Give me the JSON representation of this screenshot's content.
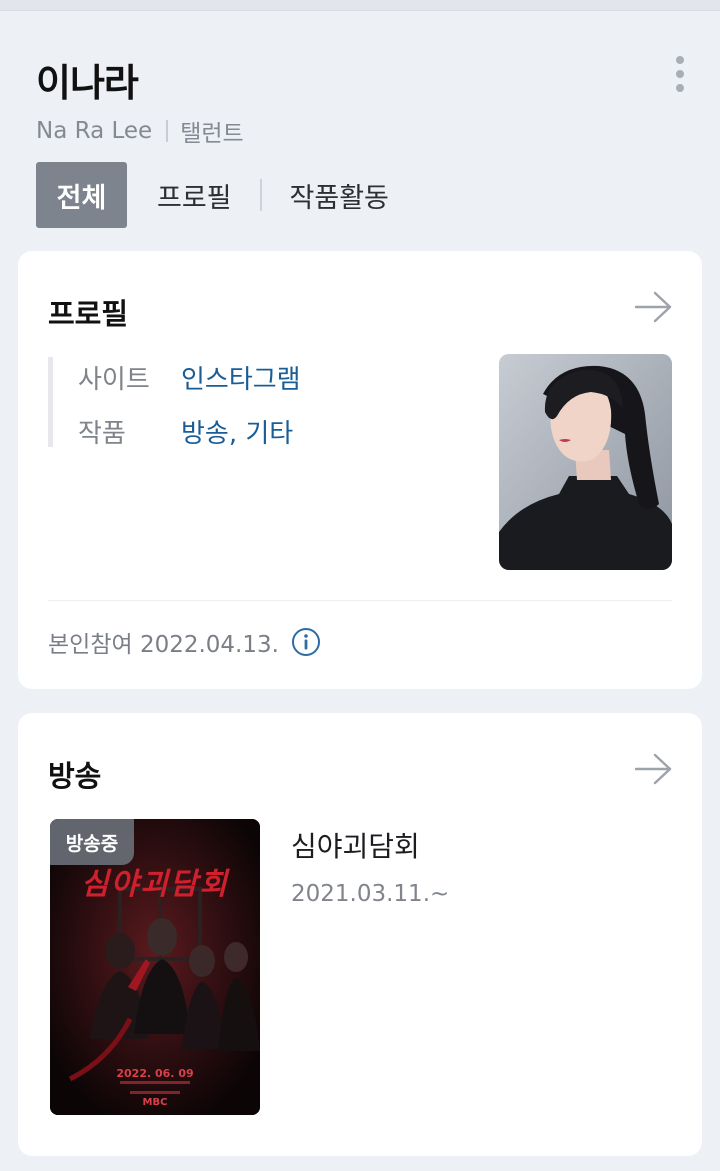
{
  "header": {
    "name": "이나라",
    "name_en": "Na Ra Lee",
    "occupation": "탤런트"
  },
  "tabs": [
    {
      "label": "전체",
      "active": true
    },
    {
      "label": "프로필",
      "active": false
    },
    {
      "label": "작품활동",
      "active": false
    }
  ],
  "profile": {
    "title": "프로필",
    "rows": [
      {
        "key": "사이트",
        "value": "인스타그램"
      },
      {
        "key": "작품",
        "value": "방송, 기타"
      }
    ],
    "participation": "본인참여 2022.04.13."
  },
  "broadcast": {
    "title": "방송",
    "items": [
      {
        "badge": "방송중",
        "title": "심야괴담회",
        "date": "2021.03.11.~",
        "poster_title": "심야괴담회",
        "poster_date": "2022. 06. 09",
        "poster_network": "MBC"
      }
    ]
  },
  "icons": {
    "more": "more-vertical-icon",
    "arrow": "arrow-right-icon",
    "info": "info-circle-icon"
  },
  "colors": {
    "background": "#edf0f5",
    "active_tab": "#7e848d",
    "link": "#1a5d96",
    "info_icon": "#2e6da4"
  }
}
